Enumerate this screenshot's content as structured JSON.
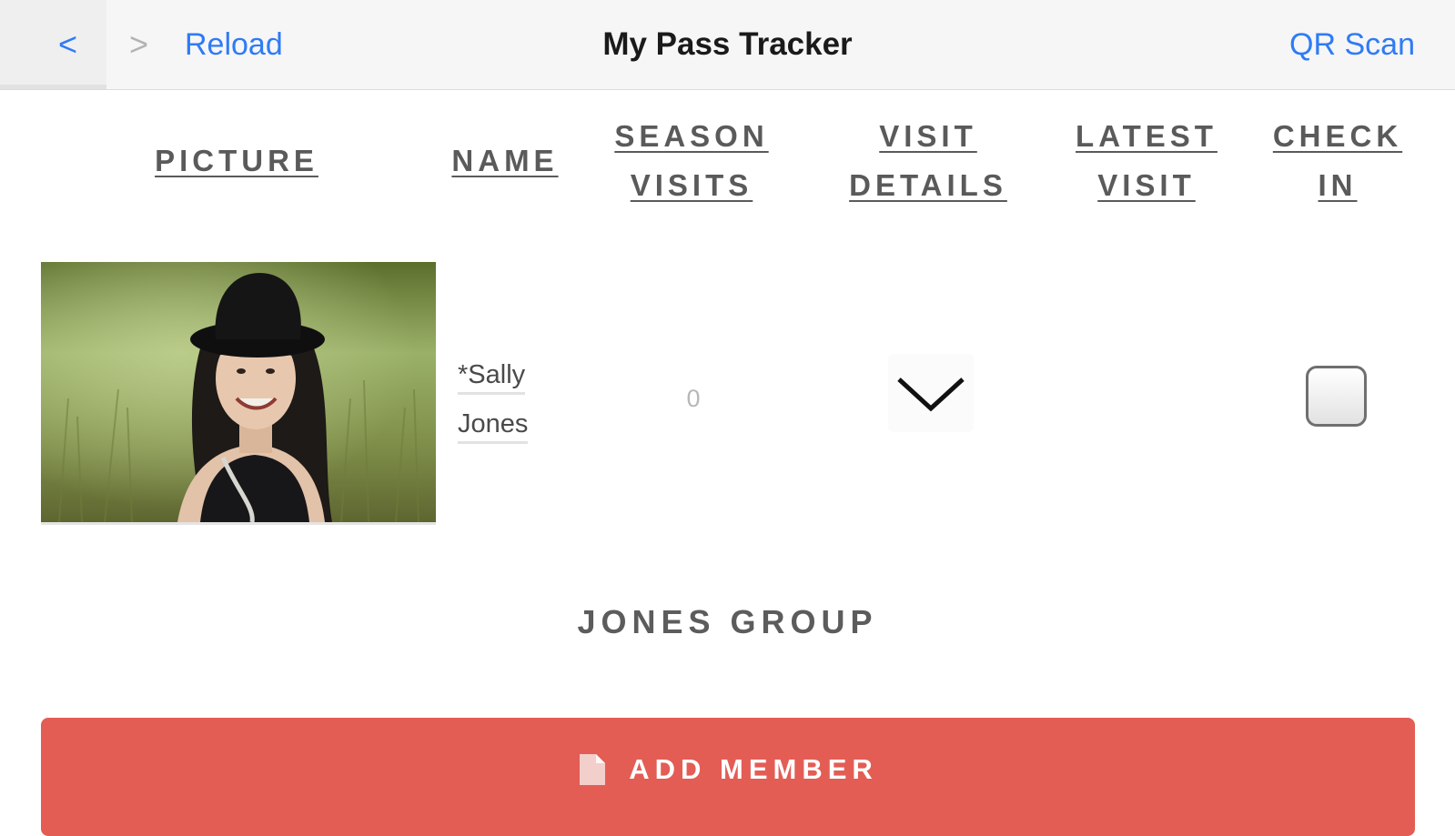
{
  "navbar": {
    "back_icon": "chevron-left-icon",
    "forward_icon": "chevron-right-icon",
    "back_glyph": "<",
    "forward_glyph": ">",
    "reload_label": "Reload",
    "title": "My Pass Tracker",
    "qr_label": "QR Scan"
  },
  "table": {
    "headers": {
      "picture": "PICTURE",
      "name": "NAME",
      "season_visits_1": "SEASON",
      "season_visits_2": "VISITS",
      "visit_details_1": "VISIT",
      "visit_details_2": "DETAILS",
      "latest_visit_1": "LATEST",
      "latest_visit_2": "VISIT",
      "check_in_1": "CHECK",
      "check_in_2": "IN"
    },
    "rows": [
      {
        "name_line1": "*Sally",
        "name_line2": "Jones",
        "season_visits": "0",
        "latest_visit": "",
        "details_icon": "chevron-down-icon",
        "checked_in": false
      }
    ]
  },
  "group": {
    "title": "JONES GROUP"
  },
  "actions": {
    "add_member_label": "ADD MEMBER",
    "add_member_icon": "document-icon"
  },
  "colors": {
    "link": "#2f7bf5",
    "accent": "#e35d55",
    "header_text": "#5a5a5a"
  }
}
